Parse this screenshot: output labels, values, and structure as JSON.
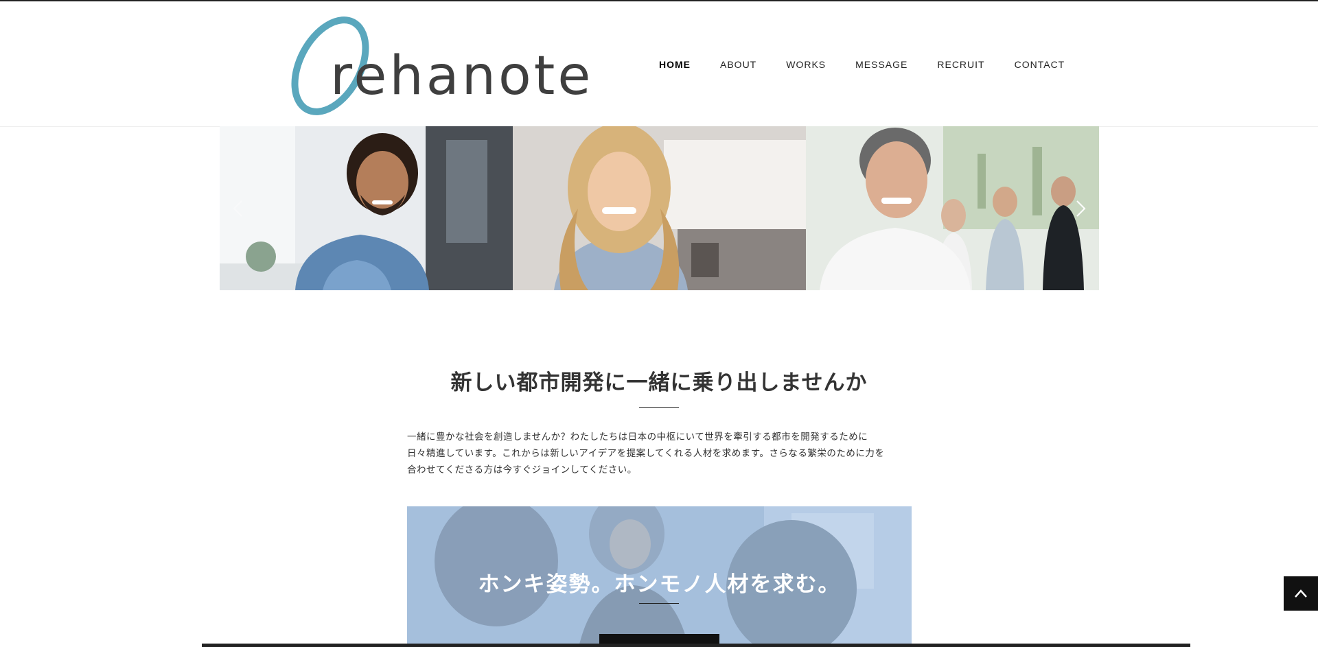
{
  "header": {
    "logo_text": "rehanote",
    "brand_color": "#5aa7bd"
  },
  "nav": {
    "items": [
      {
        "label": "HOME",
        "active": true
      },
      {
        "label": "ABOUT"
      },
      {
        "label": "WORKS"
      },
      {
        "label": "MESSAGE"
      },
      {
        "label": "RECRUIT"
      },
      {
        "label": "CONTACT"
      }
    ]
  },
  "slider": {
    "prev_icon": "chevron-left-icon",
    "next_icon": "chevron-right-icon"
  },
  "main": {
    "title": "新しい都市開発に一緒に乗り出しませんか",
    "intro_lines": [
      "一緒に豊かな社会を創造しませんか？わたしたちは日本の中枢にいて世界を牽引する都市を開発するために",
      "日々精進しています。これからは新しいアイデアを提案してくれる人材を求めます。さらなる繁栄のために力を",
      "合わせてくださる方は今すぐジョインしてください。"
    ],
    "cta_title": "ホンキ姿勢。ホンモノ人材を求む。"
  },
  "back_to_top": {
    "icon": "chevron-up-icon"
  }
}
